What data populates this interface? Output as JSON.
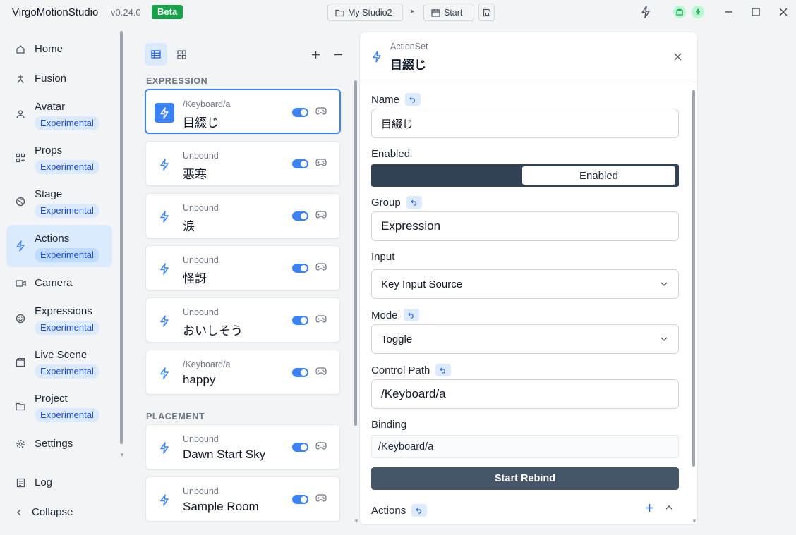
{
  "titlebar": {
    "app_name": "VirgoMotionStudio",
    "version": "v0.24.0",
    "beta": "Beta",
    "studio_button": "My Studio2",
    "start_button": "Start"
  },
  "sidebar": {
    "items": [
      {
        "label": "Home",
        "icon": "home-icon"
      },
      {
        "label": "Fusion",
        "icon": "fusion-icon"
      },
      {
        "label": "Avatar",
        "badge": "Experimental",
        "icon": "user-icon"
      },
      {
        "label": "Props",
        "badge": "Experimental",
        "icon": "grid-plus-icon"
      },
      {
        "label": "Stage",
        "badge": "Experimental",
        "icon": "globe-icon"
      },
      {
        "label": "Actions",
        "badge": "Experimental",
        "icon": "lightning-icon",
        "active": true
      },
      {
        "label": "Camera",
        "icon": "camera-icon"
      },
      {
        "label": "Expressions",
        "badge": "Experimental",
        "icon": "smile-icon"
      },
      {
        "label": "Live Scene",
        "badge": "Experimental",
        "icon": "clapper-icon"
      },
      {
        "label": "Project",
        "badge": "Experimental",
        "icon": "folder-icon"
      },
      {
        "label": "Settings",
        "icon": "gear-icon"
      }
    ],
    "log": "Log",
    "collapse": "Collapse"
  },
  "list": {
    "groups": [
      {
        "title": "EXPRESSION",
        "cards": [
          {
            "sub": "/Keyboard/a",
            "title": "目綴じ",
            "selected": true
          },
          {
            "sub": "Unbound",
            "title": "悪寒"
          },
          {
            "sub": "Unbound",
            "title": "涙"
          },
          {
            "sub": "Unbound",
            "title": "怪訝"
          },
          {
            "sub": "Unbound",
            "title": "おいしそう"
          },
          {
            "sub": "/Keyboard/a",
            "title": "happy"
          }
        ]
      },
      {
        "title": "PLACEMENT",
        "cards": [
          {
            "sub": "Unbound",
            "title": "Dawn Start Sky"
          },
          {
            "sub": "Unbound",
            "title": "Sample Room"
          }
        ]
      }
    ]
  },
  "detail": {
    "kind": "ActionSet",
    "title": "目綴じ",
    "name_label": "Name",
    "name_value": "目綴じ",
    "enabled_label": "Enabled",
    "enabled_value": "Enabled",
    "group_label": "Group",
    "group_value": "Expression",
    "input_label": "Input",
    "input_value": "Key Input Source",
    "mode_label": "Mode",
    "mode_value": "Toggle",
    "control_path_label": "Control Path",
    "control_path_value": "/Keyboard/a",
    "binding_label": "Binding",
    "binding_value": "/Keyboard/a",
    "rebind_button": "Start Rebind",
    "actions_label": "Actions"
  },
  "colors": {
    "accent": "#3b82f6",
    "beta": "#16a34a",
    "rebind": "#475569"
  }
}
